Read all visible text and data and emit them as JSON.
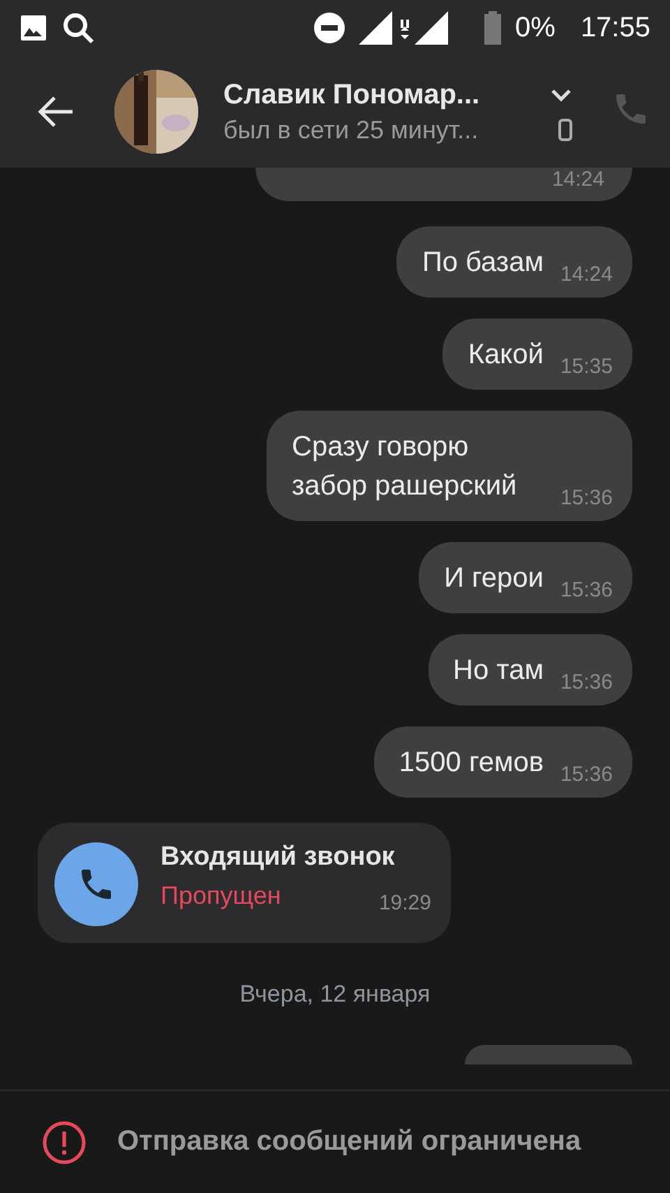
{
  "status_bar": {
    "battery": "0%",
    "time": "17:55"
  },
  "header": {
    "name": "Славик Пономар...",
    "status": "был в сети 25 минут..."
  },
  "messages": [
    {
      "kind": "cut-top",
      "time": "14:24"
    },
    {
      "kind": "outgoing",
      "text": "По базам",
      "time": "14:24"
    },
    {
      "kind": "outgoing",
      "text": "Какой",
      "time": "15:35"
    },
    {
      "kind": "outgoing",
      "text": "Сразу говорю забор рашерский",
      "time": "15:36"
    },
    {
      "kind": "outgoing",
      "text": "И герои",
      "time": "15:36"
    },
    {
      "kind": "outgoing",
      "text": "Но там",
      "time": "15:36"
    },
    {
      "kind": "outgoing",
      "text": "1500 гемов",
      "time": "15:36"
    },
    {
      "kind": "call",
      "title": "Входящий звонок",
      "status": "Пропущен",
      "time": "19:29"
    },
    {
      "kind": "date",
      "text": "Вчера, 12 января"
    },
    {
      "kind": "cut-bottom"
    }
  ],
  "notice": {
    "text": "Отправка сообщений ограничена"
  }
}
